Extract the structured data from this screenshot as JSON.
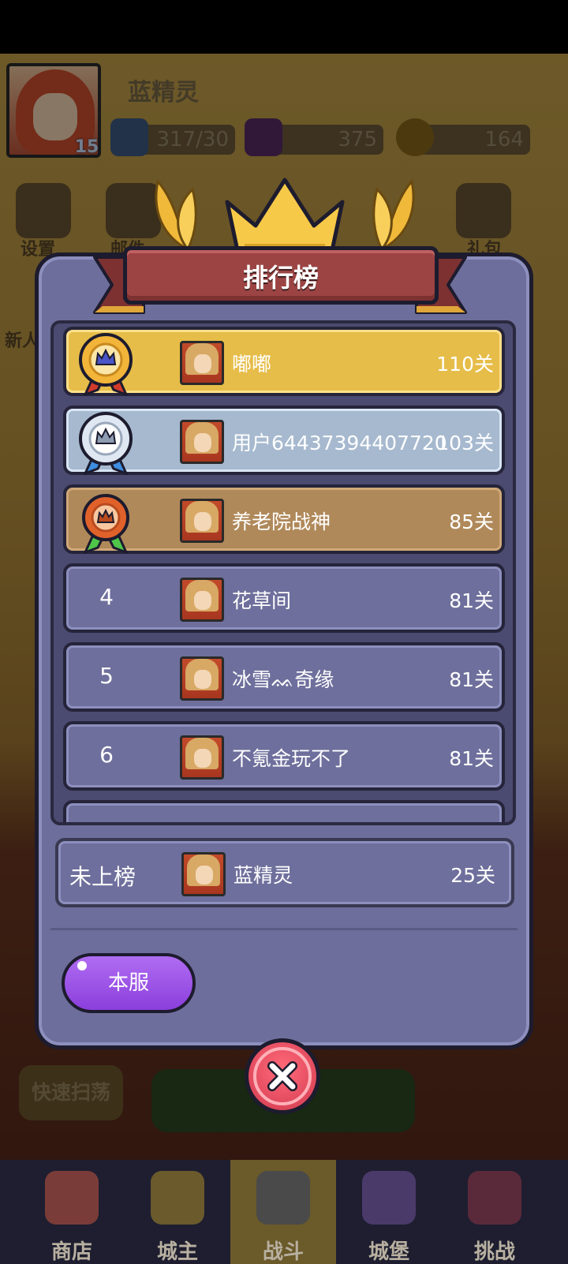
{
  "player": {
    "name": "蓝精灵",
    "level": "15"
  },
  "resources": {
    "energy": "317/30",
    "gems": "375",
    "coins": "164"
  },
  "top_icons": [
    {
      "label": "设置"
    },
    {
      "label": "邮件"
    },
    {
      "label": "礼包"
    },
    {
      "label": "新人"
    }
  ],
  "leaderboard": {
    "title": "排行榜",
    "entries": [
      {
        "rank": "1",
        "name": "嘟嘟",
        "score": "110关",
        "tier": "gold"
      },
      {
        "rank": "2",
        "name": "用户64437394407720",
        "score": "103关",
        "tier": "silver"
      },
      {
        "rank": "3",
        "name": "养老院战神",
        "score": "85关",
        "tier": "bronze"
      },
      {
        "rank": "4",
        "name": "花草间",
        "score": "81关",
        "tier": "plain"
      },
      {
        "rank": "5",
        "name": "冰雪ᨐ奇缘",
        "score": "81关",
        "tier": "plain"
      },
      {
        "rank": "6",
        "name": "不氪金玩不了",
        "score": "81关",
        "tier": "plain"
      }
    ],
    "self": {
      "rank_text": "未上榜",
      "name": "蓝精灵",
      "score": "25关"
    },
    "server_button": "本服",
    "close_icon": "close-icon"
  },
  "background": {
    "quick_sweep": "快速扫荡"
  },
  "bottom_nav": [
    {
      "label": "商店",
      "active": false
    },
    {
      "label": "城主",
      "active": false
    },
    {
      "label": "战斗",
      "active": true
    },
    {
      "label": "城堡",
      "active": false
    },
    {
      "label": "挑战",
      "active": false
    }
  ],
  "colors": {
    "modal_bg": "#6d6e9b",
    "ribbon": "#9c4444",
    "gold_row": "#e6bd49",
    "silver_row": "#a6b9cf",
    "bronze_row": "#b0895a",
    "server_button": "#8b3fdc",
    "close_button": "#d13a4e"
  }
}
